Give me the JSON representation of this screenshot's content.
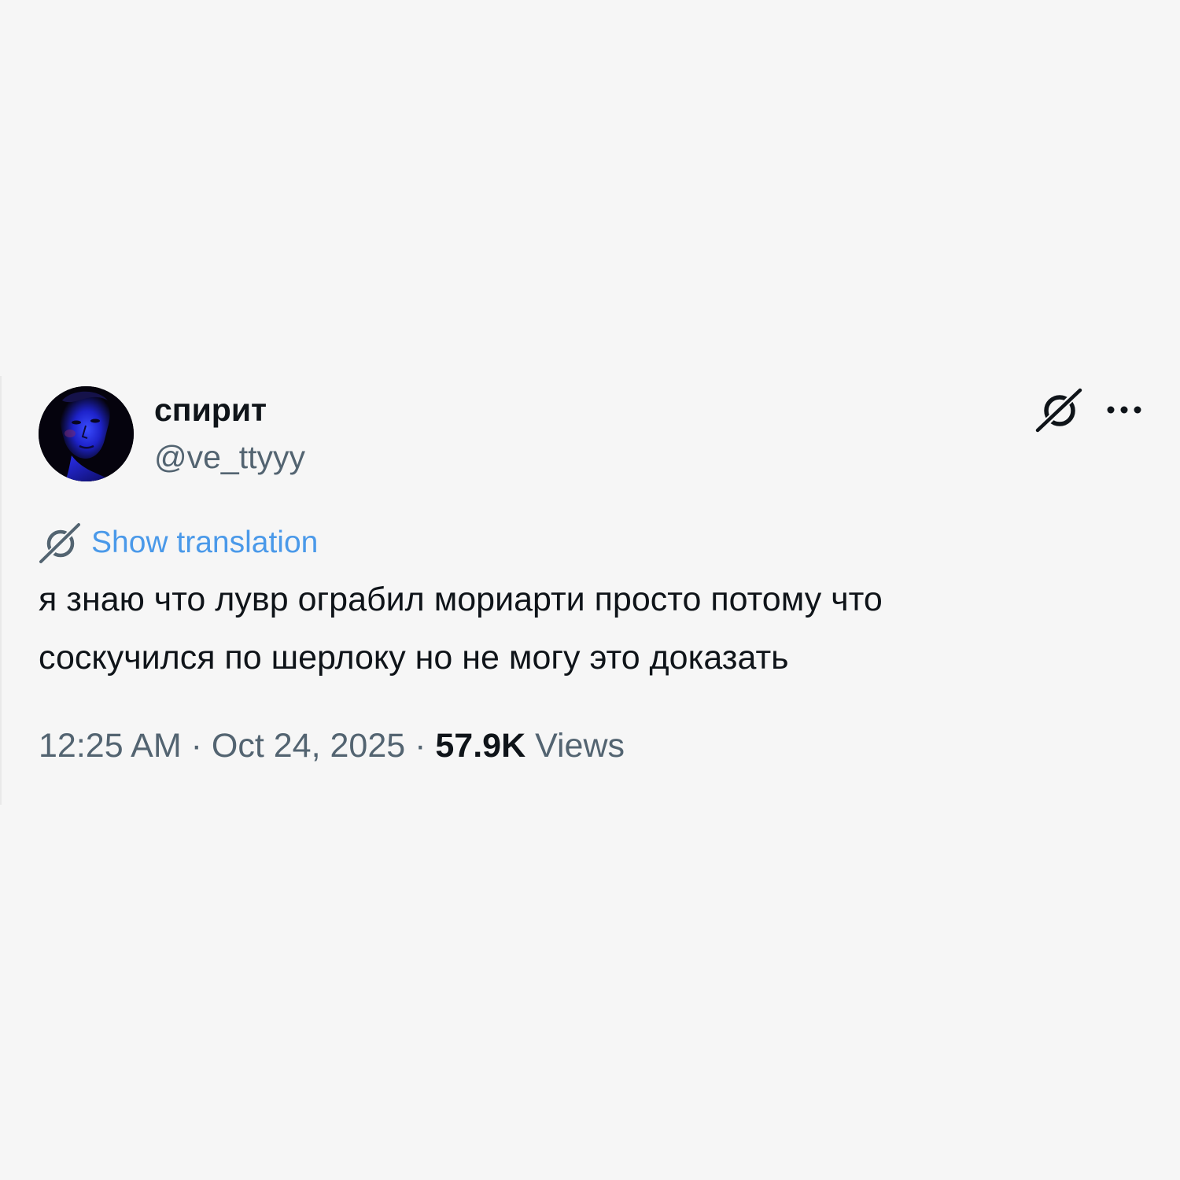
{
  "tweet": {
    "author": {
      "display_name": "спирит",
      "handle": "@ve_ttyyy",
      "avatar": "person-portrait-blue-light"
    },
    "header_actions": {
      "grok_icon": "grok-icon",
      "more_icon": "more-options-icon"
    },
    "translation": {
      "icon": "grok-icon",
      "label": "Show translation"
    },
    "text_lines": [
      "я знаю что лувр ограбил мориарти просто потому что",
      "соскучился по шерлоку но не могу это доказать"
    ],
    "meta": {
      "time": "12:25 AM",
      "separator": "·",
      "date": "Oct 24, 2025",
      "views_count": "57.9K",
      "views_label": "Views"
    }
  },
  "colors": {
    "background": "#f6f6f6",
    "primary_text": "#0f1419",
    "secondary_text": "#536471",
    "link": "#4a99e9"
  }
}
